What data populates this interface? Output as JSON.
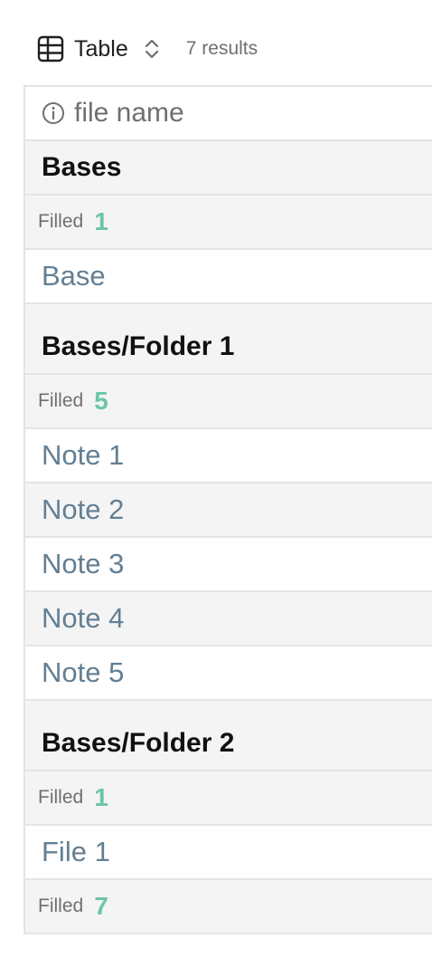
{
  "toolbar": {
    "view_label": "Table",
    "results": "7 results",
    "icons": {
      "view": "table-icon",
      "switch": "chevron-up-down-icon"
    }
  },
  "table": {
    "column_header": "file name",
    "column_icon": "info-icon",
    "groups": [
      {
        "title": "Bases",
        "summary_label": "Filled",
        "summary_value": "1",
        "rows": [
          "Base"
        ]
      },
      {
        "title": "Bases/Folder 1",
        "summary_label": "Filled",
        "summary_value": "5",
        "rows": [
          "Note 1",
          "Note 2",
          "Note 3",
          "Note 4",
          "Note 5"
        ]
      },
      {
        "title": "Bases/Folder 2",
        "summary_label": "Filled",
        "summary_value": "1",
        "rows": [
          "File 1"
        ]
      }
    ],
    "total_summary_label": "Filled",
    "total_summary_value": "7"
  },
  "colors": {
    "link": "#637f93",
    "summary_value": "#6bc5aa",
    "group_background": "#f4f4f5",
    "border": "#e4e4e4"
  }
}
